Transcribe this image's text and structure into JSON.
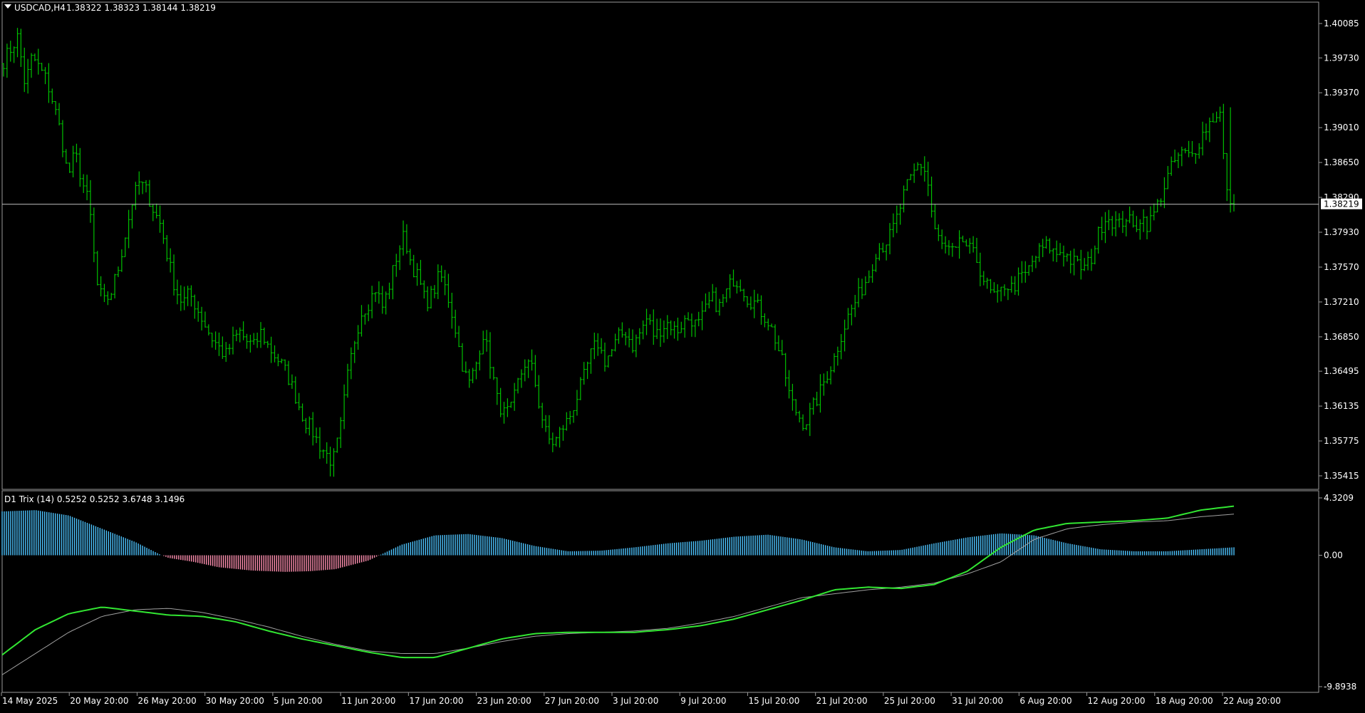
{
  "main_header": {
    "symbol": "USDCAD,H4",
    "ohlc": "1.38322 1.38323 1.38144 1.38219"
  },
  "indicator_header": {
    "text": "D1 Trix (14) 0.5252 0.5252 3.6748 3.1496"
  },
  "colors": {
    "background": "#000000",
    "candles": "#00c000",
    "price_line": "#c0c0c0",
    "hist_positive": "#4dc4ff",
    "hist_negative": "#ff8fb0",
    "trix_line": "#32e632",
    "signal_line": "#a0a0a0",
    "axis_text": "#ffffff"
  },
  "chart_data": [
    {
      "type": "candlestick",
      "title": "USDCAD,H4",
      "price_ticks": [
        "1.40085",
        "1.39730",
        "1.39370",
        "1.39010",
        "1.38650",
        "1.38290",
        "1.37930",
        "1.37570",
        "1.37210",
        "1.36850",
        "1.36495",
        "1.36135",
        "1.35775",
        "1.35415"
      ],
      "ylim": [
        1.3525,
        1.4025
      ],
      "current_price": "1.38219",
      "x_ticks": [
        "14 May 2025",
        "20 May 20:00",
        "26 May 20:00",
        "30 May 20:00",
        "5 Jun 20:00",
        "11 Jun 20:00",
        "17 Jun 20:00",
        "23 Jun 20:00",
        "27 Jun 20:00",
        "3 Jul 20:00",
        "9 Jul 20:00",
        "15 Jul 20:00",
        "21 Jul 20:00",
        "25 Jul 20:00",
        "31 Jul 20:00",
        "6 Aug 20:00",
        "12 Aug 20:00",
        "18 Aug 20:00",
        "22 Aug 20:00"
      ],
      "close_path": [
        [
          0,
          1.397
        ],
        [
          2,
          1.3995
        ],
        [
          3,
          1.3945
        ],
        [
          4,
          1.3975
        ],
        [
          6,
          1.395
        ],
        [
          7,
          1.3925
        ],
        [
          8,
          1.3895
        ],
        [
          9,
          1.385
        ],
        [
          10,
          1.3875
        ],
        [
          11,
          1.3845
        ],
        [
          12,
          1.382
        ],
        [
          13,
          1.374
        ],
        [
          14,
          1.372
        ],
        [
          15,
          1.373
        ],
        [
          16,
          1.3755
        ],
        [
          17,
          1.379
        ],
        [
          18,
          1.3825
        ],
        [
          19,
          1.3845
        ],
        [
          20,
          1.3835
        ],
        [
          21,
          1.3815
        ],
        [
          22,
          1.38
        ],
        [
          23,
          1.3765
        ],
        [
          24,
          1.3735
        ],
        [
          25,
          1.372
        ],
        [
          26,
          1.373
        ],
        [
          27,
          1.3715
        ],
        [
          28,
          1.37
        ],
        [
          29,
          1.3685
        ],
        [
          30,
          1.3675
        ],
        [
          31,
          1.3665
        ],
        [
          32,
          1.368
        ],
        [
          33,
          1.369
        ],
        [
          34,
          1.368
        ],
        [
          35,
          1.3675
        ],
        [
          36,
          1.369
        ],
        [
          37,
          1.3675
        ],
        [
          38,
          1.3665
        ],
        [
          39,
          1.3655
        ],
        [
          40,
          1.364
        ],
        [
          41,
          1.362
        ],
        [
          42,
          1.36
        ],
        [
          43,
          1.359
        ],
        [
          44,
          1.3575
        ],
        [
          45,
          1.3565
        ],
        [
          46,
          1.3555
        ],
        [
          47,
          1.3585
        ],
        [
          48,
          1.364
        ],
        [
          49,
          1.368
        ],
        [
          50,
          1.371
        ],
        [
          51,
          1.372
        ],
        [
          52,
          1.3735
        ],
        [
          53,
          1.3715
        ],
        [
          54,
          1.374
        ],
        [
          55,
          1.377
        ],
        [
          56,
          1.379
        ],
        [
          57,
          1.376
        ],
        [
          58,
          1.3745
        ],
        [
          59,
          1.372
        ],
        [
          60,
          1.373
        ],
        [
          61,
          1.375
        ],
        [
          62,
          1.373
        ],
        [
          63,
          1.37
        ],
        [
          64,
          1.366
        ],
        [
          65,
          1.3635
        ],
        [
          66,
          1.3655
        ],
        [
          67,
          1.369
        ],
        [
          68,
          1.366
        ],
        [
          69,
          1.362
        ],
        [
          70,
          1.3605
        ],
        [
          71,
          1.361
        ],
        [
          72,
          1.364
        ],
        [
          73,
          1.366
        ],
        [
          74,
          1.365
        ],
        [
          75,
          1.361
        ],
        [
          76,
          1.358
        ],
        [
          77,
          1.3575
        ],
        [
          78,
          1.359
        ],
        [
          79,
          1.36
        ],
        [
          80,
          1.362
        ],
        [
          81,
          1.364
        ],
        [
          82,
          1.3665
        ],
        [
          83,
          1.368
        ],
        [
          84,
          1.366
        ],
        [
          85,
          1.367
        ],
        [
          86,
          1.3685
        ],
        [
          87,
          1.369
        ],
        [
          88,
          1.3675
        ],
        [
          89,
          1.369
        ],
        [
          90,
          1.3705
        ],
        [
          91,
          1.3685
        ],
        [
          92,
          1.3695
        ],
        [
          93,
          1.37
        ],
        [
          94,
          1.369
        ],
        [
          95,
          1.37
        ],
        [
          96,
          1.3705
        ],
        [
          97,
          1.3695
        ],
        [
          98,
          1.371
        ],
        [
          99,
          1.3725
        ],
        [
          100,
          1.3715
        ],
        [
          101,
          1.373
        ],
        [
          102,
          1.3745
        ],
        [
          103,
          1.374
        ],
        [
          104,
          1.3725
        ],
        [
          105,
          1.372
        ],
        [
          106,
          1.371
        ],
        [
          107,
          1.37
        ],
        [
          108,
          1.368
        ],
        [
          109,
          1.3655
        ],
        [
          110,
          1.362
        ],
        [
          111,
          1.3605
        ],
        [
          112,
          1.3595
        ],
        [
          113,
          1.361
        ],
        [
          114,
          1.3625
        ],
        [
          115,
          1.3645
        ],
        [
          116,
          1.366
        ],
        [
          117,
          1.3685
        ],
        [
          118,
          1.3705
        ],
        [
          119,
          1.372
        ],
        [
          120,
          1.3735
        ],
        [
          121,
          1.375
        ],
        [
          122,
          1.3775
        ],
        [
          123,
          1.378
        ],
        [
          124,
          1.379
        ],
        [
          125,
          1.381
        ],
        [
          126,
          1.3835
        ],
        [
          127,
          1.385
        ],
        [
          128,
          1.3865
        ],
        [
          129,
          1.3855
        ],
        [
          130,
          1.38
        ],
        [
          131,
          1.378
        ],
        [
          132,
          1.3775
        ],
        [
          133,
          1.377
        ],
        [
          134,
          1.3785
        ],
        [
          135,
          1.3775
        ],
        [
          136,
          1.3765
        ],
        [
          137,
          1.3745
        ],
        [
          138,
          1.373
        ],
        [
          139,
          1.3725
        ],
        [
          140,
          1.374
        ],
        [
          141,
          1.3735
        ],
        [
          142,
          1.3745
        ],
        [
          143,
          1.375
        ],
        [
          144,
          1.3765
        ],
        [
          145,
          1.3775
        ],
        [
          146,
          1.378
        ],
        [
          147,
          1.377
        ],
        [
          148,
          1.3775
        ],
        [
          149,
          1.3765
        ],
        [
          150,
          1.376
        ],
        [
          151,
          1.3755
        ],
        [
          152,
          1.3765
        ],
        [
          153,
          1.379
        ],
        [
          154,
          1.381
        ],
        [
          155,
          1.3805
        ],
        [
          156,
          1.38
        ],
        [
          157,
          1.381
        ],
        [
          158,
          1.3795
        ],
        [
          159,
          1.381
        ],
        [
          160,
          1.38
        ],
        [
          161,
          1.3815
        ],
        [
          162,
          1.3835
        ],
        [
          163,
          1.3855
        ],
        [
          164,
          1.387
        ],
        [
          165,
          1.3875
        ],
        [
          166,
          1.387
        ],
        [
          167,
          1.3885
        ],
        [
          168,
          1.39
        ],
        [
          169,
          1.391
        ],
        [
          170,
          1.392
        ],
        [
          171,
          1.3832
        ],
        [
          172,
          1.38219
        ]
      ],
      "last_candle": {
        "open": 1.38322,
        "high": 1.38323,
        "low": 1.38144,
        "close": 1.38219
      }
    },
    {
      "type": "indicator",
      "title": "D1 Trix (14)",
      "values": [
        0.5252,
        0.5252,
        3.6748,
        3.1496
      ],
      "axis_ticks": [
        "4.3209",
        "0.00",
        "-9.8938"
      ],
      "ylim": [
        -9.8938,
        4.3209
      ],
      "histogram": [
        [
          0,
          3.3
        ],
        [
          20,
          3.4
        ],
        [
          40,
          3.0
        ],
        [
          60,
          2.0
        ],
        [
          80,
          1.0
        ],
        [
          95,
          0.05
        ],
        [
          100,
          -0.2
        ],
        [
          115,
          -0.5
        ],
        [
          130,
          -0.9
        ],
        [
          150,
          -1.15
        ],
        [
          170,
          -1.25
        ],
        [
          185,
          -1.2
        ],
        [
          200,
          -1.05
        ],
        [
          220,
          -0.4
        ],
        [
          240,
          0.8
        ],
        [
          260,
          1.5
        ],
        [
          280,
          1.6
        ],
        [
          300,
          1.3
        ],
        [
          320,
          0.7
        ],
        [
          340,
          0.3
        ],
        [
          360,
          0.35
        ],
        [
          380,
          0.6
        ],
        [
          400,
          0.9
        ],
        [
          420,
          1.1
        ],
        [
          440,
          1.4
        ],
        [
          460,
          1.55
        ],
        [
          480,
          1.2
        ],
        [
          500,
          0.6
        ],
        [
          520,
          0.3
        ],
        [
          540,
          0.4
        ],
        [
          560,
          0.9
        ],
        [
          580,
          1.35
        ],
        [
          600,
          1.65
        ],
        [
          620,
          1.5
        ],
        [
          640,
          0.9
        ],
        [
          660,
          0.45
        ],
        [
          680,
          0.3
        ],
        [
          700,
          0.3
        ],
        [
          720,
          0.45
        ],
        [
          740,
          0.6
        ]
      ],
      "trix_line": [
        [
          0,
          -7.5
        ],
        [
          20,
          -5.6
        ],
        [
          40,
          -4.4
        ],
        [
          60,
          -3.9
        ],
        [
          80,
          -4.2
        ],
        [
          100,
          -4.5
        ],
        [
          120,
          -4.6
        ],
        [
          140,
          -5.0
        ],
        [
          160,
          -5.7
        ],
        [
          180,
          -6.3
        ],
        [
          200,
          -6.8
        ],
        [
          220,
          -7.3
        ],
        [
          240,
          -7.7
        ],
        [
          260,
          -7.7
        ],
        [
          280,
          -7.0
        ],
        [
          300,
          -6.3
        ],
        [
          320,
          -5.9
        ],
        [
          340,
          -5.8
        ],
        [
          360,
          -5.8
        ],
        [
          380,
          -5.8
        ],
        [
          400,
          -5.6
        ],
        [
          420,
          -5.3
        ],
        [
          440,
          -4.8
        ],
        [
          460,
          -4.1
        ],
        [
          480,
          -3.4
        ],
        [
          500,
          -2.6
        ],
        [
          520,
          -2.4
        ],
        [
          540,
          -2.5
        ],
        [
          560,
          -2.2
        ],
        [
          580,
          -1.2
        ],
        [
          600,
          0.6
        ],
        [
          620,
          1.9
        ],
        [
          640,
          2.4
        ],
        [
          660,
          2.5
        ],
        [
          680,
          2.6
        ],
        [
          700,
          2.8
        ],
        [
          720,
          3.4
        ],
        [
          740,
          3.7
        ]
      ],
      "signal_line": [
        [
          0,
          -9.0
        ],
        [
          20,
          -7.4
        ],
        [
          40,
          -5.8
        ],
        [
          60,
          -4.6
        ],
        [
          80,
          -4.1
        ],
        [
          100,
          -4.0
        ],
        [
          120,
          -4.3
        ],
        [
          140,
          -4.8
        ],
        [
          160,
          -5.4
        ],
        [
          180,
          -6.1
        ],
        [
          200,
          -6.7
        ],
        [
          220,
          -7.2
        ],
        [
          240,
          -7.4
        ],
        [
          260,
          -7.4
        ],
        [
          280,
          -7.0
        ],
        [
          300,
          -6.5
        ],
        [
          320,
          -6.1
        ],
        [
          340,
          -5.9
        ],
        [
          360,
          -5.8
        ],
        [
          380,
          -5.7
        ],
        [
          400,
          -5.5
        ],
        [
          420,
          -5.1
        ],
        [
          440,
          -4.6
        ],
        [
          460,
          -3.9
        ],
        [
          480,
          -3.2
        ],
        [
          500,
          -2.9
        ],
        [
          520,
          -2.6
        ],
        [
          540,
          -2.4
        ],
        [
          560,
          -2.1
        ],
        [
          580,
          -1.4
        ],
        [
          600,
          -0.5
        ],
        [
          620,
          1.2
        ],
        [
          640,
          2.0
        ],
        [
          660,
          2.3
        ],
        [
          680,
          2.5
        ],
        [
          700,
          2.6
        ],
        [
          720,
          2.9
        ],
        [
          740,
          3.1
        ]
      ]
    }
  ]
}
